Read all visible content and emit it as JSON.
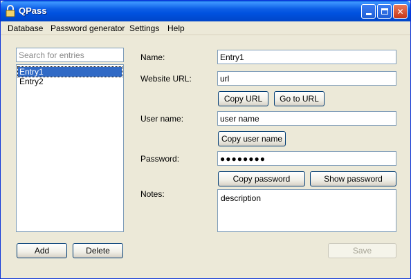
{
  "window": {
    "title": "QPass"
  },
  "menu": {
    "database": "Database",
    "password_generator": "Password generator",
    "settings": "Settings",
    "help": "Help"
  },
  "search": {
    "placeholder": "Search for entries",
    "value": ""
  },
  "entries": [
    "Entry1",
    "Entry2"
  ],
  "form": {
    "name_label": "Name:",
    "name_value": "Entry1",
    "url_label": "Website URL:",
    "url_value": "url",
    "copy_url": "Copy URL",
    "go_to_url": "Go to URL",
    "username_label": "User name:",
    "username_value": "user name",
    "copy_username": "Copy user name",
    "password_label": "Password:",
    "password_value": "●●●●●●●●",
    "copy_password": "Copy password",
    "show_password": "Show password",
    "notes_label": "Notes:",
    "notes_value": "description"
  },
  "actions": {
    "add": "Add",
    "delete": "Delete",
    "save": "Save"
  },
  "colors": {
    "titlebar": "#0052e0",
    "selection": "#316ac5",
    "window_bg": "#ece9d8",
    "field_border": "#7f9db9"
  }
}
